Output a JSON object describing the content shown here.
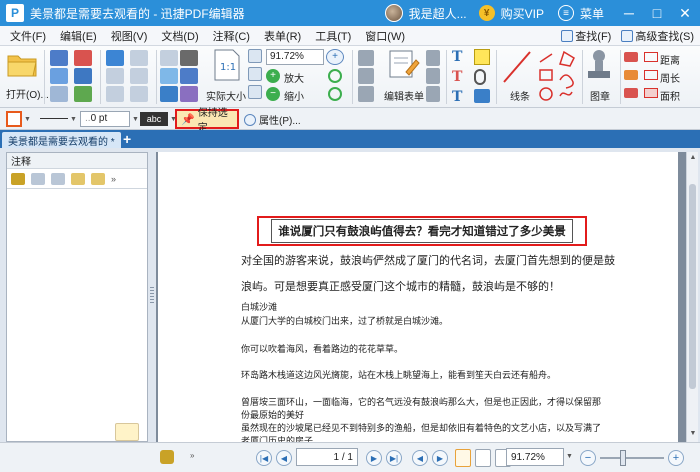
{
  "window": {
    "logo": "P",
    "title": "美景都是需要去观看的 - 迅捷PDF编辑器",
    "user_name": "我是超人...",
    "vip_label": "购买VIP",
    "menu_label": "菜单",
    "minimize": "─",
    "maximize": "□",
    "close": "✕"
  },
  "menubar": {
    "items": [
      "文件(F)",
      "编辑(E)",
      "视图(V)",
      "文档(D)",
      "注释(C)",
      "表单(R)",
      "工具(T)",
      "窗口(W)"
    ],
    "find_label": "查找(F)",
    "advanced_find_label": "高级查找(S)"
  },
  "ribbon": {
    "open_label": "打开(O)...",
    "actual_size_label": "实际大小",
    "zoom_value": "91.72%",
    "zoom_in_label": "放大",
    "zoom_out_label": "缩小",
    "edit_form_label": "编辑表单",
    "line_label": "线条",
    "stamp_label": "图章",
    "distance_label": "距离",
    "perimeter_label": "周长",
    "area_label": "面积"
  },
  "proptools": {
    "line_width": "0 pt",
    "text_style": "abc",
    "keep_selected_label": "保持选定",
    "properties_label": "属性(P)..."
  },
  "tabs": {
    "doc_tab_label": "美景都是需要去观看的 *",
    "new_tab": "+"
  },
  "panel": {
    "title": "注释"
  },
  "document": {
    "title": "谁说厦门只有鼓浪屿值得去？看完才知道错过了多少美景",
    "para1": "对全国的游客来说，鼓浪屿俨然成了厦门的代名词，去厦门首先想到的便是鼓",
    "para2": "浪屿。可是想要真正感受厦门这个城市的精髓，鼓浪屿是不够的！",
    "line3": "白城沙滩",
    "line4": "从厦门大学的白城校门出来，过了桥就是白城沙滩。",
    "line5": "你可以吹着海风，看着路边的花花草草。",
    "line6": "环岛路木栈道这边风光旖旎，站在木栈上眺望海上，能看到笙天白云还有船舟。",
    "line7": "曾厝垵三面环山，一面临海，它的名气远没有鼓浪屿那么大，但是也正因此，才得以保留那",
    "line8": "份最原始的美好",
    "line9": "虽然现在的沙坡尾已经见不到特别多的渔船，但是却依旧有着特色的文艺小店，以及写满了",
    "line10": "老厦门历史的房子"
  },
  "statusbar": {
    "page_field": "1 / 1",
    "zoom_value": "91.72%"
  },
  "colors": {
    "titlebar": "#2b8fd9",
    "tabstrip": "#2b6fb5",
    "highlight_border": "#e21b1b",
    "vip": "#f5c028"
  }
}
